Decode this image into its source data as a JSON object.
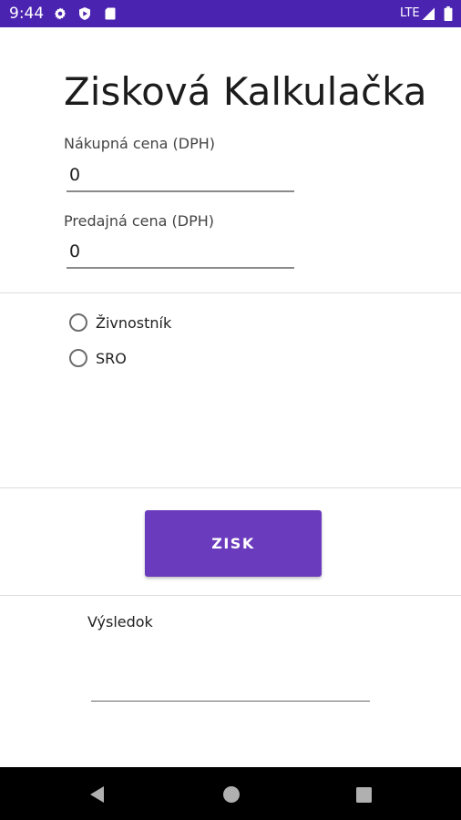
{
  "status_bar": {
    "time": "9:44",
    "network": "LTE",
    "icons": [
      "settings-icon",
      "shield-icon",
      "sd-card-icon",
      "signal-icon",
      "battery-icon"
    ],
    "background_color": "#4a23b0"
  },
  "app": {
    "title": "Zisková Kalkulačka",
    "purchase_price": {
      "label": "Nákupná cena (DPH)",
      "value": "0"
    },
    "selling_price": {
      "label": "Predajná cena (DPH)",
      "value": "0"
    },
    "entity_type": {
      "options": [
        {
          "label": "Živnostník",
          "selected": false
        },
        {
          "label": "SRO",
          "selected": false
        }
      ]
    },
    "action_button": {
      "label": "ZISK",
      "color": "#6a3bbd"
    },
    "result": {
      "label": "Výsledok",
      "value": ""
    }
  },
  "nav_bar": {
    "icons": [
      "back-icon",
      "home-icon",
      "recents-icon"
    ]
  }
}
